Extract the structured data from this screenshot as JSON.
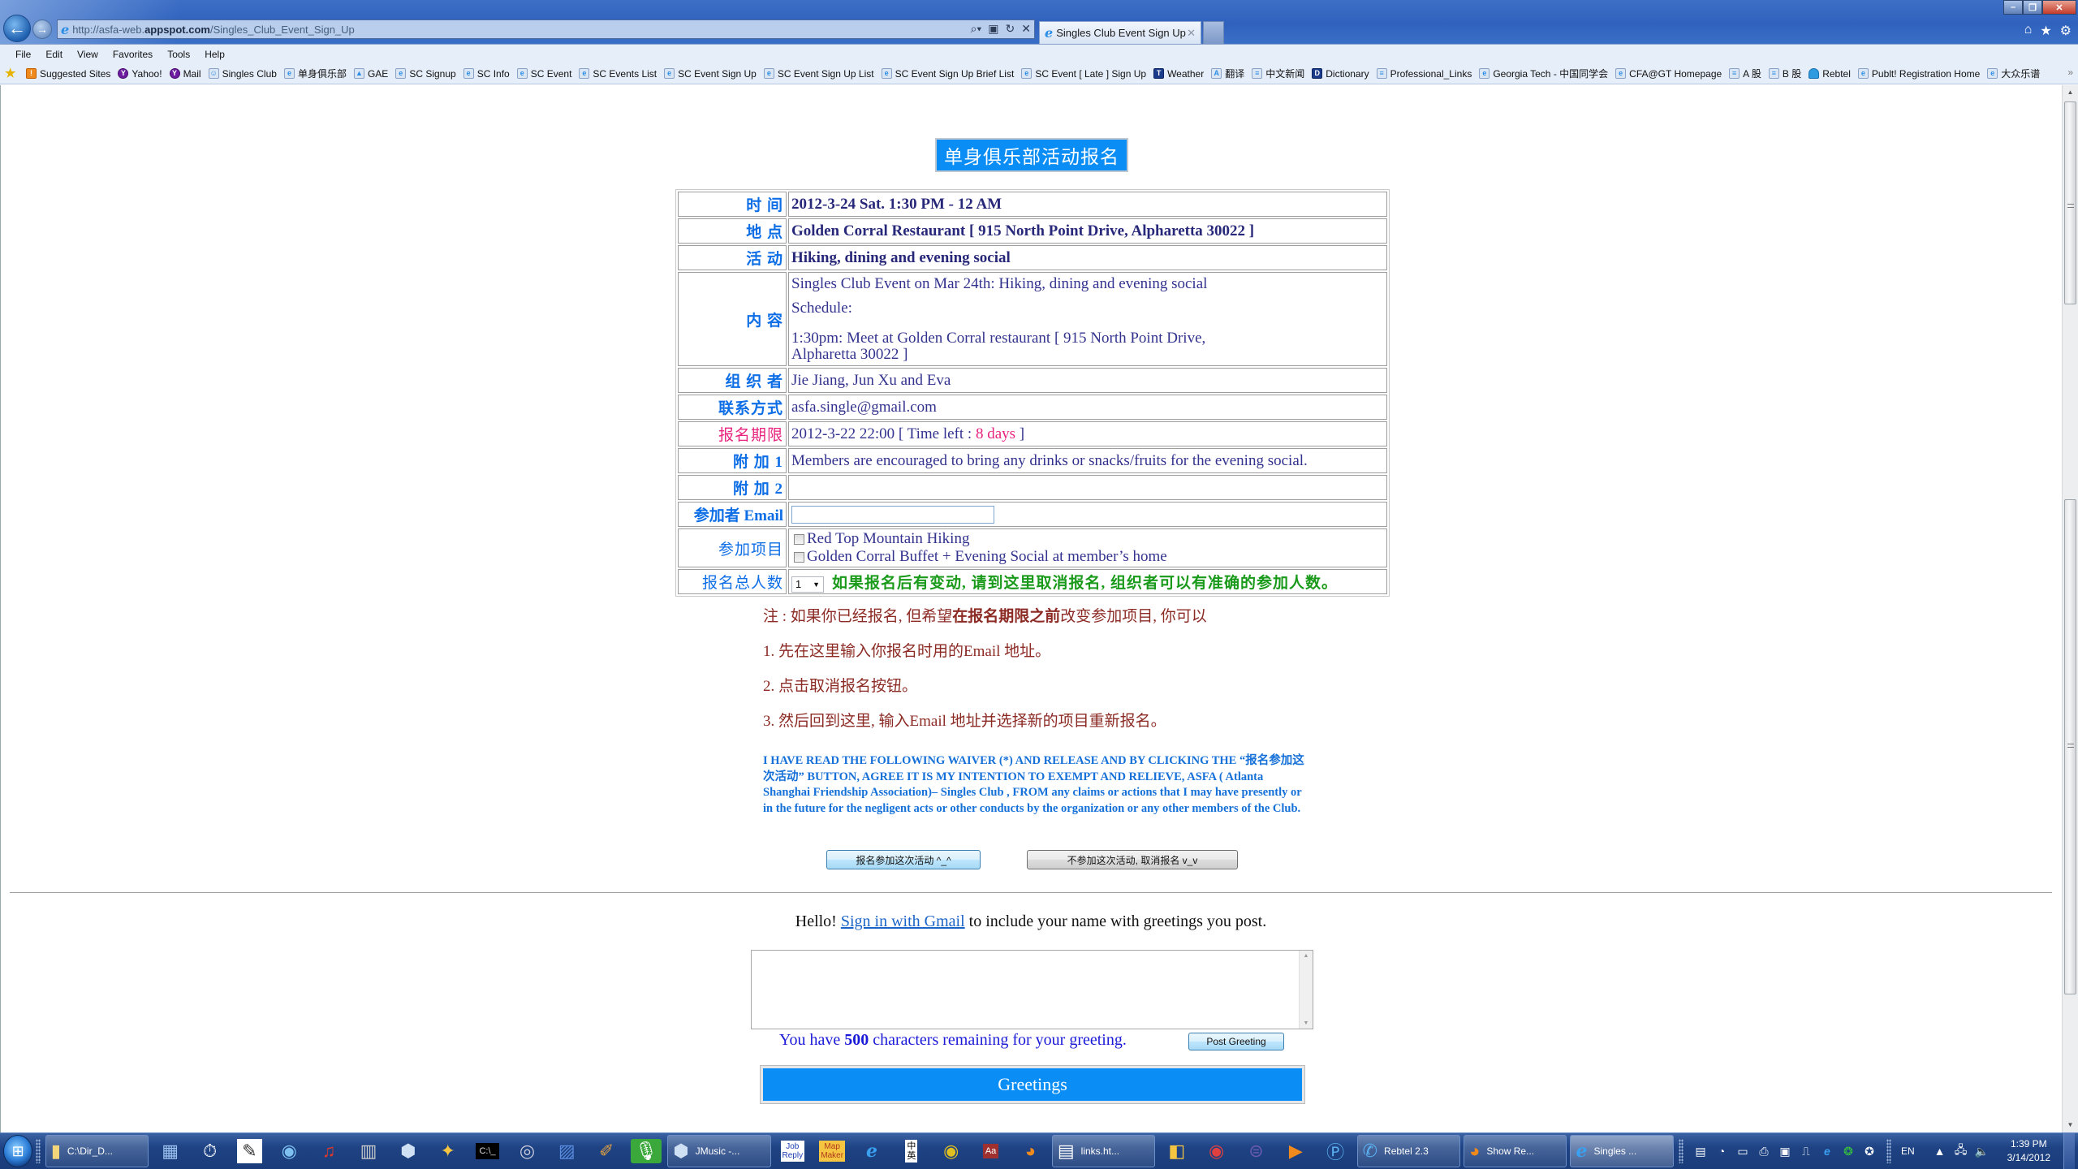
{
  "browser": {
    "url_prefix": "http://asfa-web.",
    "url_domain": "appspot.com",
    "url_path": "/Singles_Club_Event_Sign_Up",
    "tab_title": "Singles Club Event Sign Up",
    "menu": [
      "File",
      "Edit",
      "View",
      "Favorites",
      "Tools",
      "Help"
    ],
    "favorites": [
      {
        "label": "Suggested Sites",
        "icon": "suggested-sites-icon"
      },
      {
        "label": "Yahoo!",
        "icon": "yahoo-icon"
      },
      {
        "label": "Mail",
        "icon": "yahoo-mail-icon"
      },
      {
        "label": "Singles Club",
        "icon": "chat-icon"
      },
      {
        "label": "单身俱乐部",
        "icon": "ie-page-icon"
      },
      {
        "label": "GAE",
        "icon": "gae-icon"
      },
      {
        "label": "SC Signup",
        "icon": "ie-page-icon"
      },
      {
        "label": "SC Info",
        "icon": "ie-page-icon"
      },
      {
        "label": "SC Event",
        "icon": "ie-page-icon"
      },
      {
        "label": "SC Events List",
        "icon": "ie-page-icon"
      },
      {
        "label": "SC Event Sign Up",
        "icon": "ie-page-icon"
      },
      {
        "label": "SC Event Sign Up List",
        "icon": "ie-page-icon"
      },
      {
        "label": "SC Event Sign Up Brief List",
        "icon": "ie-page-icon"
      },
      {
        "label": "SC Event [ Late ] Sign Up",
        "icon": "ie-page-icon"
      },
      {
        "label": "Weather",
        "icon": "twc-icon"
      },
      {
        "label": "翻译",
        "icon": "translate-icon"
      },
      {
        "label": "中文新闻",
        "icon": "page-icon"
      },
      {
        "label": "Dictionary",
        "icon": "dictionary-icon"
      },
      {
        "label": "Professional_Links",
        "icon": "page-icon"
      },
      {
        "label": "Georgia Tech - 中国同学会",
        "icon": "ie-page-icon"
      },
      {
        "label": "CFA@GT Homepage",
        "icon": "ie-page-icon"
      },
      {
        "label": "A 股",
        "icon": "page-icon"
      },
      {
        "label": "B 股",
        "icon": "page-icon"
      },
      {
        "label": "Rebtel",
        "icon": "rebtel-icon"
      },
      {
        "label": "Publt! Registration Home",
        "icon": "ie-page-icon"
      },
      {
        "label": "大众乐谱",
        "icon": "ie-page-icon"
      }
    ],
    "favorites_overflow": "»"
  },
  "page": {
    "title": "单身俱乐部活动报名",
    "rows": {
      "time": {
        "label": "时 间",
        "value": "2012-3-24 Sat. 1:30 PM - 12 AM"
      },
      "location": {
        "label": "地 点",
        "value": "Golden Corral Restaurant [ 915 North Point Drive, Alpharetta 30022 ]"
      },
      "activity": {
        "label": "活 动",
        "value": "Hiking, dining and evening social"
      },
      "content": {
        "label": "内 容",
        "line1": "Singles Club Event on Mar 24th: Hiking, dining and evening social",
        "line2": "Schedule:",
        "line3": "1:30pm: Meet at Golden Corral restaurant [ 915 North Point Drive,",
        "line4": "Alpharetta 30022 ]"
      },
      "organizers": {
        "label": "组 织 者",
        "value": "Jie Jiang, Jun Xu and Eva"
      },
      "contact": {
        "label": "联系方式",
        "value": "asfa.single@gmail.com"
      },
      "deadline": {
        "label": "报名期限",
        "value_prefix": "2012-3-22 22:00 [ Time left : ",
        "time_left": "8 days",
        "value_suffix": " ]"
      },
      "extra1": {
        "label": "附 加 1",
        "value": "Members are encouraged to bring any drinks or snacks/fruits for the evening social."
      },
      "extra2": {
        "label": "附 加 2",
        "value": ""
      },
      "email": {
        "label": "参加者 Email",
        "value": "",
        "placeholder": ""
      },
      "items": {
        "label": "参加项目",
        "options": [
          {
            "label": "Red Top Mountain Hiking",
            "checked": false
          },
          {
            "label": "Golden Corral Buffet + Evening Social at member’s home",
            "checked": false
          }
        ]
      },
      "count": {
        "label": "报名总人数",
        "selected": "1",
        "note": "如果报名后有变动, 请到这里取消报名, 组织者可以有准确的参加人数。"
      }
    },
    "notes": {
      "intro_a": "注 : 如果你已经报名, 但希望",
      "intro_bold": "在报名期限之前",
      "intro_b": "改变参加项目, 你可以",
      "step1": "1. 先在这里输入你报名时用的Email 地址。",
      "step2": "2. 点击取消报名按钮。",
      "step3": "3. 然后回到这里, 输入Email 地址并选择新的项目重新报名。"
    },
    "waiver": "I HAVE READ THE FOLLOWING WAIVER (*) AND RELEASE AND BY CLICKING THE “报名参加这次活动” BUTTON, AGREE IT IS MY INTENTION TO EXEMPT AND RELIEVE, ASFA ( Atlanta Shanghai Friendship Association)– Singles Club , FROM any claims or actions that I may have presently or in the future for the negligent acts or other conducts by the organization or any other members of the Club.",
    "signup_button": "报名参加这次活动 ^_^",
    "cancel_button": "不参加这次活动, 取消报名 v_v",
    "greeting": {
      "hello_prefix": "Hello! ",
      "signin_link": "Sign in with Gmail",
      "hello_suffix": " to include your name with greetings you post.",
      "textarea_value": "",
      "remain_prefix": "You have ",
      "remain_count": "500",
      "remain_suffix": " characters remaining for your greeting.",
      "post_button": "Post Greeting",
      "section_title": "Greetings"
    }
  },
  "taskbar": {
    "buttons": [
      {
        "label": "C:\\Dir_D...",
        "icon": "folder-icon"
      },
      {
        "label": "JMusic -...",
        "icon": "jmusic-icon"
      },
      {
        "label": "links.ht...",
        "icon": "notepad-icon"
      },
      {
        "label": "Rebtel 2.3",
        "icon": "rebtel-icon"
      },
      {
        "label": "Show Re...",
        "icon": "firefox-icon"
      },
      {
        "label": "Singles ...",
        "icon": "ie-icon"
      }
    ],
    "language": "EN",
    "time": "1:39 PM",
    "date": "3/14/2012"
  },
  "colors": {
    "header_blue": "#0a8ef5",
    "label_blue": "#0d6ee6",
    "value_navy": "#33338f",
    "deadline_pink": "#e8237e",
    "note_green": "#1a9a1a",
    "notes_brown": "#8c2a24",
    "waiver_blue": "#1570d8"
  }
}
